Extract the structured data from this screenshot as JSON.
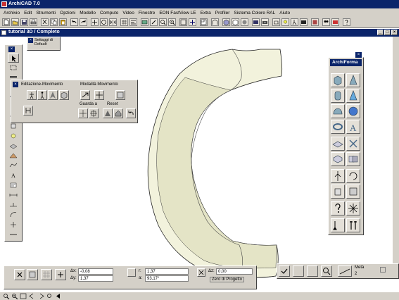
{
  "app": {
    "title": "ArchiCAD 7.0"
  },
  "menu": [
    "Archivio",
    "Edit",
    "Strumenti",
    "Opzioni",
    "Modello",
    "Computo",
    "Video",
    "Finestre",
    "EON FastView LE",
    "Extra",
    "Profiler",
    "Sistema Colore RAL",
    "Aiuto"
  ],
  "document": {
    "title": "tutorial 3D / Completo"
  },
  "settings_popup": {
    "line1": "Settaggi di",
    "line2": "Default"
  },
  "movement_palette": {
    "title_left": "Editazione-Movimento",
    "title_right": "Modalità Movimento",
    "label_look": "Guarda a",
    "label_reset": "Reset"
  },
  "archiforma": {
    "title": "ArchiForma"
  },
  "infobox": {
    "dx_label": "Δx:",
    "dx_value": "-0,08",
    "dy_label": "Δy:",
    "dy_value": "1,37",
    "r_label": "r:",
    "r_value": "1,37",
    "a_label": "a:",
    "a_value": "93,17°",
    "dz_label": "Δz:",
    "dz_value": "0,00",
    "ref_label": "Zero di Progetto"
  },
  "infobox2": {
    "snap_label": "Metà",
    "snap_value": "2"
  },
  "colors": {
    "titlebar": "#0a246a",
    "chrome": "#d4d0c8",
    "model_fill": "#f2f2dc",
    "model_shadow": "#d9d9bb"
  },
  "icons": {
    "left_tools": [
      "arrow-icon",
      "marquee-icon",
      "wall-icon",
      "column-icon",
      "beam-icon",
      "door-icon",
      "window-icon",
      "object-icon",
      "lamp-icon",
      "slab-icon",
      "roof-icon",
      "mesh-icon",
      "text-icon",
      "label-icon",
      "dimension-icon",
      "level-icon",
      "radial-dim-icon",
      "angle-dim-icon",
      "hotspot-icon",
      "line-icon",
      "arc-icon",
      "polyline-icon",
      "fill-icon",
      "camera-icon",
      "section-icon",
      "stair-icon"
    ]
  }
}
